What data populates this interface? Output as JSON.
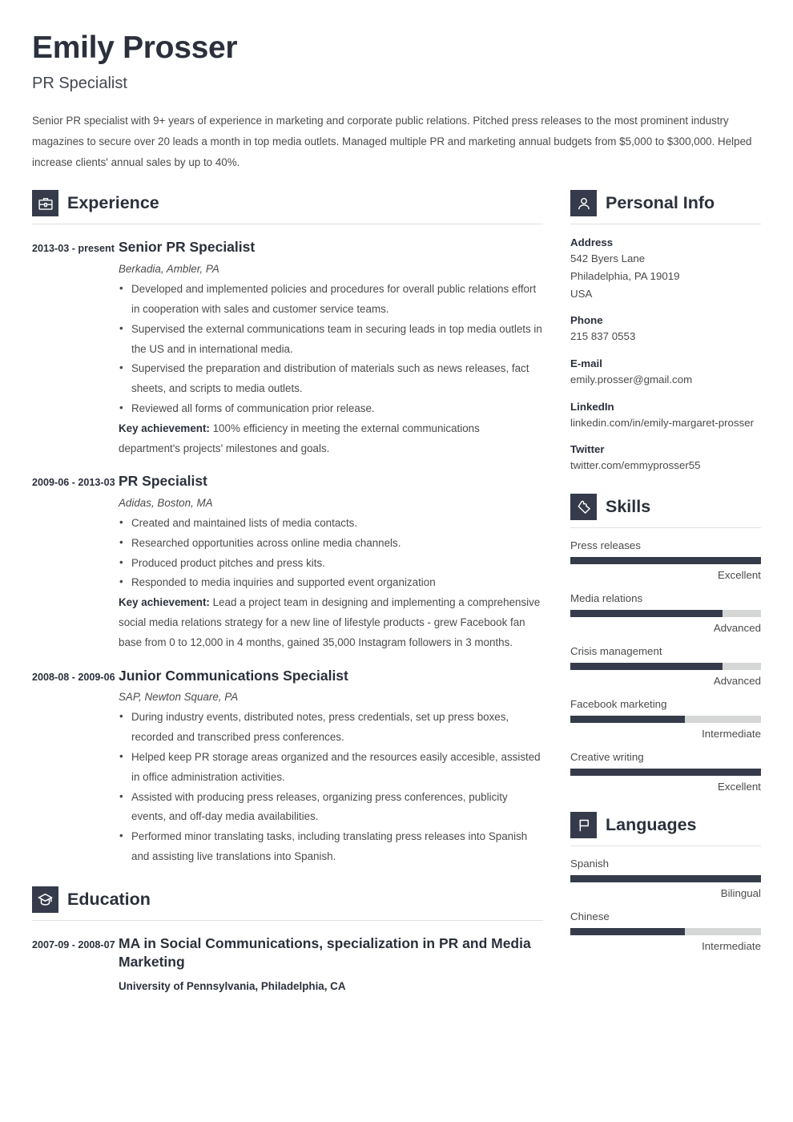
{
  "header": {
    "name": "Emily Prosser",
    "job_title": "PR Specialist",
    "summary": "Senior PR specialist with 9+ years of experience in marketing and corporate public relations. Pitched press releases to the most prominent industry magazines to secure over 20 leads a month in top media outlets. Managed multiple PR and marketing annual budgets from $5,000 to $300,000. Helped increase clients' annual sales by up to 40%."
  },
  "theme": {
    "accent_dark": "#353b4a",
    "heading_color": "#2b303c",
    "body_color": "#4b4b4b",
    "bar_track": "#d5d7d7",
    "divider": "#e2e2e2"
  },
  "experience": {
    "title": "Experience",
    "icon": "briefcase-icon",
    "entries": [
      {
        "dates": "2013-03 - present",
        "role": "Senior PR Specialist",
        "company": "Berkadia, Ambler, PA",
        "bullets": [
          "Developed and implemented policies and procedures for overall public relations effort in cooperation with sales and customer service teams.",
          "Supervised the external communications team in securing leads in top media outlets in the US and in international media.",
          "Supervised the preparation and distribution of materials such as news releases, fact sheets, and scripts to media outlets.",
          "Reviewed all forms of communication prior release."
        ],
        "key_achievement_label": "Key achievement:",
        "key_achievement": "100% efficiency in meeting the external communications department's projects' milestones and goals."
      },
      {
        "dates": "2009-06 - 2013-03",
        "role": "PR Specialist",
        "company": "Adidas, Boston, MA",
        "bullets": [
          "Created and maintained lists of media contacts.",
          "Researched opportunities across online media channels.",
          "Produced product pitches and press kits.",
          "Responded to media inquiries and supported event organization"
        ],
        "key_achievement_label": "Key achievement:",
        "key_achievement": "Lead a project team in designing and implementing a comprehensive social media relations strategy for a new line of lifestyle products - grew Facebook fan base from 0 to 12,000 in 4 months, gained 35,000 Instagram followers in 3 months."
      },
      {
        "dates": "2008-08 - 2009-06",
        "role": "Junior Communications Specialist",
        "company": "SAP, Newton Square, PA",
        "bullets": [
          "During industry events, distributed notes, press credentials, set up press boxes, recorded and transcribed press conferences.",
          "Helped keep PR storage areas organized and the resources easily accesible, assisted in office administration activities.",
          "Assisted with producing press releases, organizing press conferences, publicity events, and off-day media availabilities.",
          "Performed minor translating tasks, including translating press releases into Spanish and assisting live translations into Spanish."
        ]
      }
    ]
  },
  "education": {
    "title": "Education",
    "icon": "graduation-cap-icon",
    "entries": [
      {
        "dates": "2007-09 - 2008-07",
        "degree": "MA in Social Communications, specialization in PR and Media Marketing",
        "school": "University of Pennsylvania, Philadelphia, CA"
      }
    ]
  },
  "personal_info": {
    "title": "Personal Info",
    "icon": "person-icon",
    "fields": [
      {
        "label": "Address",
        "value": "542 Byers Lane\nPhiladelphia, PA 19019\nUSA"
      },
      {
        "label": "Phone",
        "value": "215 837 0553"
      },
      {
        "label": "E-mail",
        "value": "emily.prosser@gmail.com"
      },
      {
        "label": "LinkedIn",
        "value": "linkedin.com/in/emily-margaret-prosser"
      },
      {
        "label": "Twitter",
        "value": "twitter.com/emmyprosser55"
      }
    ]
  },
  "skills": {
    "title": "Skills",
    "icon": "puzzle-piece-icon",
    "items": [
      {
        "name": "Press releases",
        "level": "Excellent",
        "percent": 100
      },
      {
        "name": "Media relations",
        "level": "Advanced",
        "percent": 80
      },
      {
        "name": "Crisis management",
        "level": "Advanced",
        "percent": 80
      },
      {
        "name": "Facebook marketing",
        "level": "Intermediate",
        "percent": 60
      },
      {
        "name": "Creative writing",
        "level": "Excellent",
        "percent": 100
      }
    ]
  },
  "languages": {
    "title": "Languages",
    "icon": "flag-icon",
    "items": [
      {
        "name": "Spanish",
        "level": "Bilingual",
        "percent": 100
      },
      {
        "name": "Chinese",
        "level": "Intermediate",
        "percent": 60
      }
    ]
  }
}
